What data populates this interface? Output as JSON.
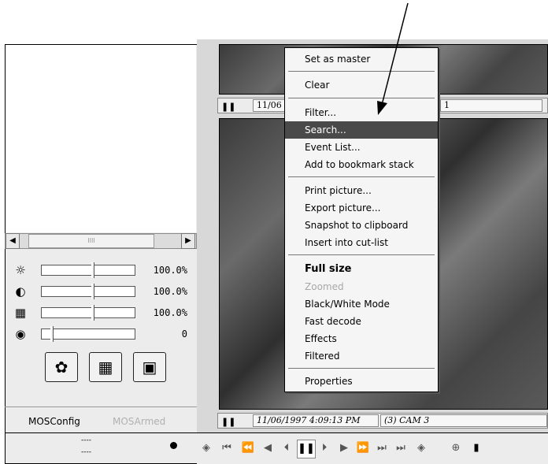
{
  "video_panels": {
    "top_info": {
      "date_fragment": "11/06",
      "cam_fragment": "1"
    },
    "bottom_info": {
      "datetime": "11/06/1997 4:09:13 PM",
      "camera": "(3) CAM 3"
    }
  },
  "left_panel": {
    "scrollbar": {
      "thumb_grip": "IIII"
    },
    "sliders": [
      {
        "icon": "brightness-icon",
        "value": "100.0%",
        "level_percent": 50
      },
      {
        "icon": "contrast-icon",
        "value": "100.0%",
        "level_percent": 50
      },
      {
        "icon": "saturation-icon",
        "value": "100.0%",
        "level_percent": 50
      },
      {
        "icon": "volume-icon",
        "value": "0",
        "level_percent": 0
      }
    ],
    "tool_buttons": [
      "settings-icon",
      "grid-icon",
      "save-icon"
    ],
    "status": {
      "config": "MOSConfig",
      "armed": "MOSArmed",
      "dash1": "----",
      "dash2": "----"
    }
  },
  "context_menu": {
    "items": [
      {
        "label": "Set as master"
      },
      {
        "label": "Clear"
      },
      {
        "label": "Filter..."
      },
      {
        "label": "Search...",
        "selected": true
      },
      {
        "label": "Event List..."
      },
      {
        "label": "Add to bookmark stack"
      },
      {
        "label": "Print picture..."
      },
      {
        "label": "Export picture..."
      },
      {
        "label": "Snapshot to clipboard"
      },
      {
        "label": "Insert into cut-list"
      },
      {
        "label": "Full size",
        "bold": true
      },
      {
        "label": "Zoomed",
        "disabled": true
      },
      {
        "label": "Black/White Mode"
      },
      {
        "label": "Fast decode"
      },
      {
        "label": "Effects"
      },
      {
        "label": "Filtered"
      },
      {
        "label": "Properties"
      }
    ]
  }
}
